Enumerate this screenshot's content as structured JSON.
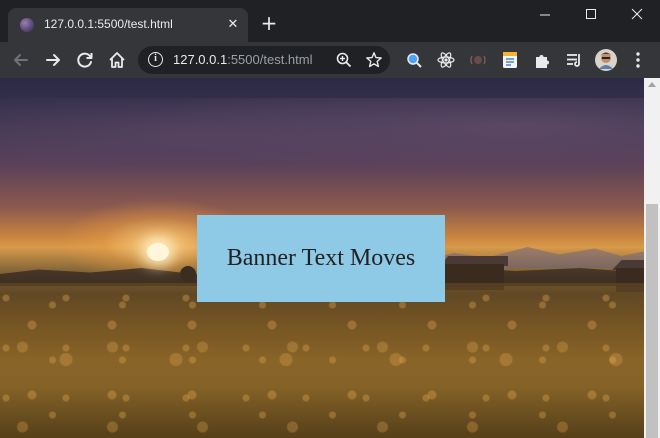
{
  "tab": {
    "title": "127.0.0.1:5500/test.html",
    "close_glyph": "✕",
    "favicon": "globe-icon"
  },
  "new_tab_glyph": "+",
  "window_controls": {
    "minimize_glyph": "—",
    "maximize_glyph": "☐",
    "close_glyph": "✕"
  },
  "toolbar": {
    "icons": [
      "back-icon",
      "forward-icon",
      "reload-icon",
      "home-icon"
    ],
    "extension_icons": [
      "search-extension-icon",
      "react-devtools-icon",
      "media-extension-icon",
      "notes-extension-icon",
      "extensions-puzzle-icon",
      "media-queue-icon",
      "profile-avatar",
      "menu-kebab-icon"
    ]
  },
  "omnibox": {
    "host": "127.0.0.1",
    "rest": ":5500/test.html",
    "info_glyph": "i",
    "icons": [
      "zoom-icon",
      "bookmark-star-icon"
    ]
  },
  "page": {
    "banner_text": "Banner Text Moves",
    "banner_color": "#8ecae6"
  },
  "colors": {
    "tabstrip": "#202124",
    "toolbar": "#35363a",
    "text": "#e8eaed",
    "url_muted": "#9aa0a6"
  }
}
